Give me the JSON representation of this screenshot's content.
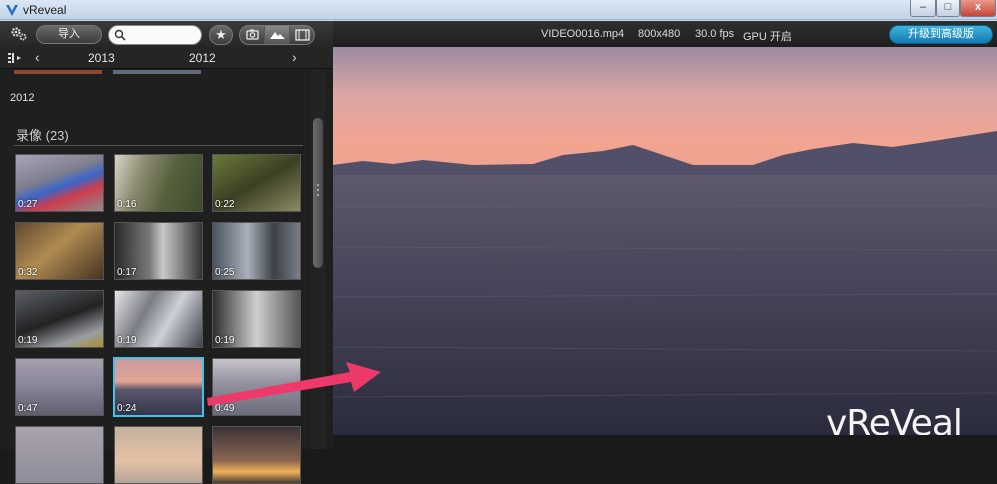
{
  "window": {
    "title": "vReveal",
    "minimize_glyph": "–",
    "maximize_glyph": "□",
    "close_glyph": "x"
  },
  "toolbar": {
    "import_label": "导入",
    "search_placeholder": "",
    "favorite_glyph": "★",
    "settings_icon": "gears-icon",
    "view_icons": [
      "camera-icon",
      "landscape-icon",
      "film-icon"
    ]
  },
  "date_nav": {
    "prev_glyph": "‹",
    "next_glyph": "›",
    "years": [
      "2013",
      "2012"
    ]
  },
  "library": {
    "year": "2012",
    "section_title": "录像 (23)",
    "thumbnails": [
      {
        "duration": "0:27",
        "selected": false
      },
      {
        "duration": "0:16",
        "selected": false
      },
      {
        "duration": "0:22",
        "selected": false
      },
      {
        "duration": "0:32",
        "selected": false
      },
      {
        "duration": "0:17",
        "selected": false
      },
      {
        "duration": "0:25",
        "selected": false
      },
      {
        "duration": "0:19",
        "selected": false
      },
      {
        "duration": "0:19",
        "selected": false
      },
      {
        "duration": "0:19",
        "selected": false
      },
      {
        "duration": "0:47",
        "selected": false
      },
      {
        "duration": "0:24",
        "selected": true
      },
      {
        "duration": "0:49",
        "selected": false
      },
      {
        "duration": "",
        "selected": false
      },
      {
        "duration": "",
        "selected": false
      },
      {
        "duration": "",
        "selected": false
      }
    ]
  },
  "player": {
    "file_name": "VIDEO0016.mp4",
    "resolution": "800x480",
    "fps": "30.0 fps",
    "gpu": "GPU 开启",
    "upgrade_label": "升级到高级版",
    "watermark": "vReVeal"
  },
  "colors": {
    "accent": "#3ec4ee",
    "upgrade": "#1a8cc6",
    "arrow": "#ee3a6a"
  }
}
